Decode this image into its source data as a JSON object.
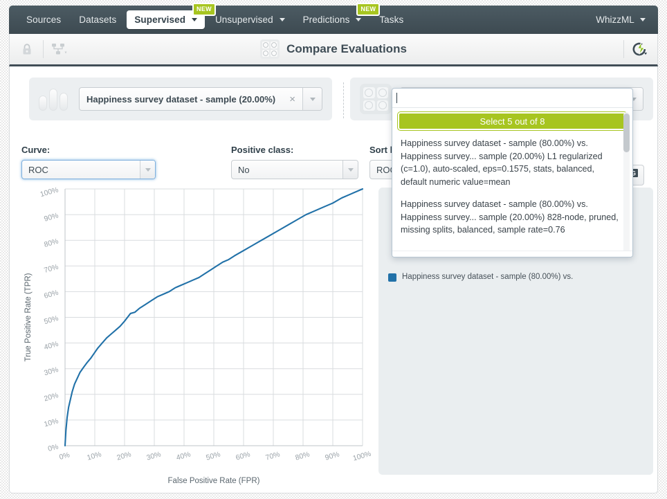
{
  "nav": {
    "items": [
      {
        "label": "Sources",
        "caret": false,
        "active": false,
        "badge": null
      },
      {
        "label": "Datasets",
        "caret": false,
        "active": false,
        "badge": null
      },
      {
        "label": "Supervised",
        "caret": true,
        "active": true,
        "badge": "NEW"
      },
      {
        "label": "Unsupervised",
        "caret": true,
        "active": false,
        "badge": null
      },
      {
        "label": "Predictions",
        "caret": true,
        "active": false,
        "badge": "NEW"
      },
      {
        "label": "Tasks",
        "caret": false,
        "active": false,
        "badge": null
      }
    ],
    "account": "WhizzML"
  },
  "toolbar": {
    "lock_icon": "lock-icon",
    "share_icon": "share-network-icon",
    "title": "Compare Evaluations",
    "title_icon": "evaluation-grid-icon",
    "action_icon": "lightning-refresh-icon"
  },
  "selectors": {
    "dataset": {
      "icon": "dataset-bars-icon",
      "value": "Happiness survey dataset - sample (20.00%)",
      "clear": "×"
    },
    "evaluation": {
      "icon": "evaluation-grid-icon",
      "value": ""
    }
  },
  "controls": {
    "curve": {
      "label": "Curve:",
      "value": "ROC"
    },
    "positive_class": {
      "label": "Positive class:",
      "value": "No"
    },
    "sort_by": {
      "label": "Sort b",
      "value": "ROC"
    }
  },
  "popup": {
    "search_value": "",
    "select_button": "Select 5 out of 8",
    "items": [
      "Happiness survey dataset - sample (80.00%) vs. Happiness survey... sample (20.00%)\nL1 regularized (c=1.0), auto-scaled, eps=0.1575, stats, balanced, default numeric value=mean",
      "Happiness survey dataset - sample (80.00%) vs. Happiness survey... sample (20.00%)\n828-node, pruned, missing splits, balanced, sample rate=0.76"
    ]
  },
  "legend": {
    "entry": "Happiness survey dataset - sample (80.00%) vs."
  },
  "export": {
    "icon": "export-image-icon",
    "label": "G"
  },
  "colors": {
    "nav_bg": "#414e56",
    "accent_green": "#a7c520",
    "curve_blue": "#2171a8",
    "panel_bg": "#eaeef0"
  },
  "chart_data": {
    "type": "line",
    "title": "",
    "xlabel": "False Positive Rate (FPR)",
    "ylabel": "True Positive Rate (TPR)",
    "xlim": [
      0,
      100
    ],
    "ylim": [
      0,
      100
    ],
    "grid": true,
    "legend_position": "right-panel",
    "xticks": [
      "0%",
      "10%",
      "20%",
      "30%",
      "40%",
      "50%",
      "60%",
      "70%",
      "80%",
      "90%",
      "100%"
    ],
    "yticks": [
      "0%",
      "10%",
      "20%",
      "30%",
      "40%",
      "50%",
      "60%",
      "70%",
      "80%",
      "90%",
      "100%"
    ],
    "series": [
      {
        "name": "ROC curve",
        "color": "#2171a8",
        "x": [
          0,
          0.3,
          0.7,
          1.2,
          1.8,
          2.4,
          3.2,
          4.0,
          5.0,
          6.2,
          7.5,
          8.6,
          9.8,
          11.0,
          12.5,
          14.0,
          15.5,
          17.0,
          18.5,
          20.0,
          21.0,
          22.0,
          23.5,
          25.0,
          27.0,
          29.0,
          31.0,
          33.0,
          35.0,
          37.0,
          39.0,
          41.0,
          43.0,
          45.0,
          47.0,
          49.0,
          51.0,
          53.0,
          55.0,
          57.0,
          60.0,
          63.0,
          66.0,
          69.0,
          72.0,
          75.0,
          78.0,
          81.0,
          84.0,
          87.0,
          90.0,
          93.0,
          96.0,
          100.0
        ],
        "y": [
          0,
          6,
          11,
          15,
          18,
          21,
          24,
          26,
          28.5,
          30.5,
          32.5,
          34.0,
          36.0,
          38.0,
          40.0,
          42.0,
          43.5,
          45.0,
          46.5,
          48.5,
          50.0,
          51.5,
          52.0,
          53.5,
          55.0,
          56.5,
          58.0,
          59.0,
          60.0,
          61.5,
          62.5,
          63.5,
          64.5,
          65.5,
          67.0,
          68.5,
          70.0,
          71.5,
          72.5,
          74.0,
          76.0,
          78.0,
          80.0,
          82.0,
          84.0,
          86.0,
          88.0,
          90.0,
          91.5,
          93.0,
          94.5,
          96.5,
          98.0,
          100.0
        ]
      }
    ]
  }
}
